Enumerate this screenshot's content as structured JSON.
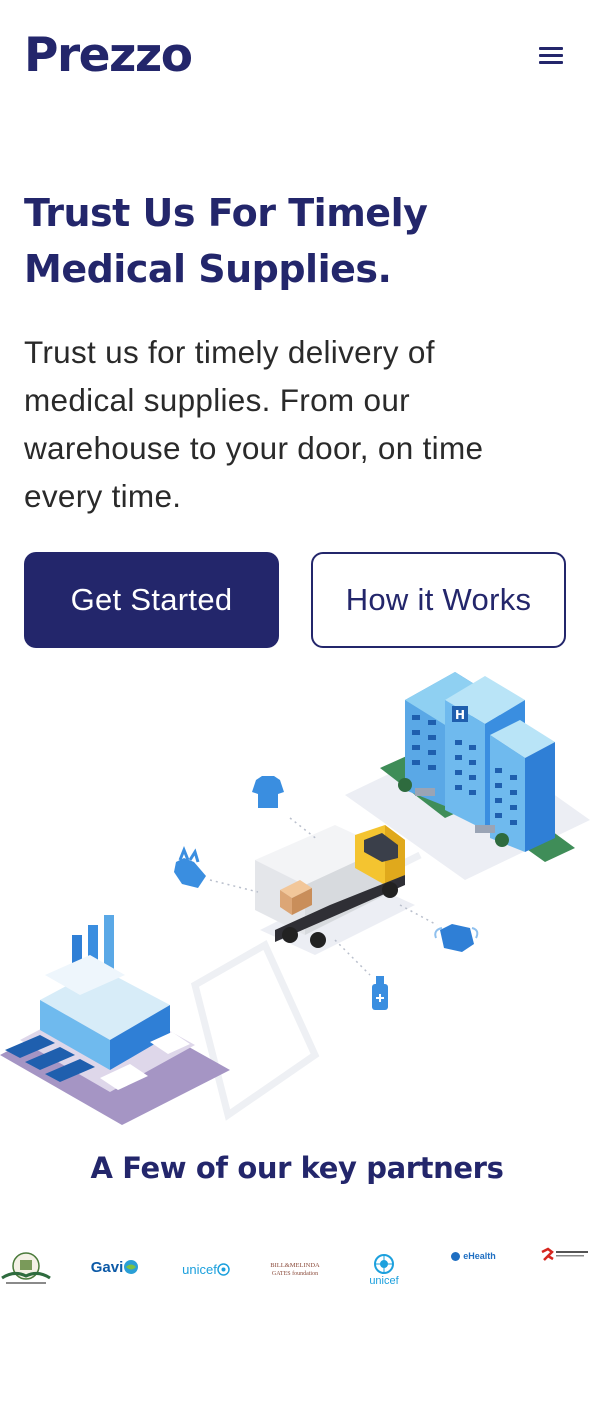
{
  "header": {
    "logo": "Prezzo",
    "menu_icon": "hamburger-menu-icon"
  },
  "hero": {
    "title_line1": "Trust Us For Timely",
    "title_line2": "Medical Supplies.",
    "description": "Trust us for timely delivery of medical supplies. From our warehouse to your door, on time every time.",
    "primary_button": "Get Started",
    "secondary_button": "How it Works"
  },
  "illustration": {
    "hospital_sign": "H"
  },
  "partners": {
    "title": "A Few of our key partners",
    "logos": {
      "gavi": "Gavi",
      "unicef_wordmark": "unicef",
      "gates_line1": "BILL&MELINDA",
      "gates_line2": "GATES foundation",
      "unicef_emblem": "unicef",
      "ehealth": "eHealth"
    }
  },
  "colors": {
    "brand_navy": "#23266b",
    "accent_blue": "#2f7fd6",
    "truck_yellow": "#f4c430"
  }
}
